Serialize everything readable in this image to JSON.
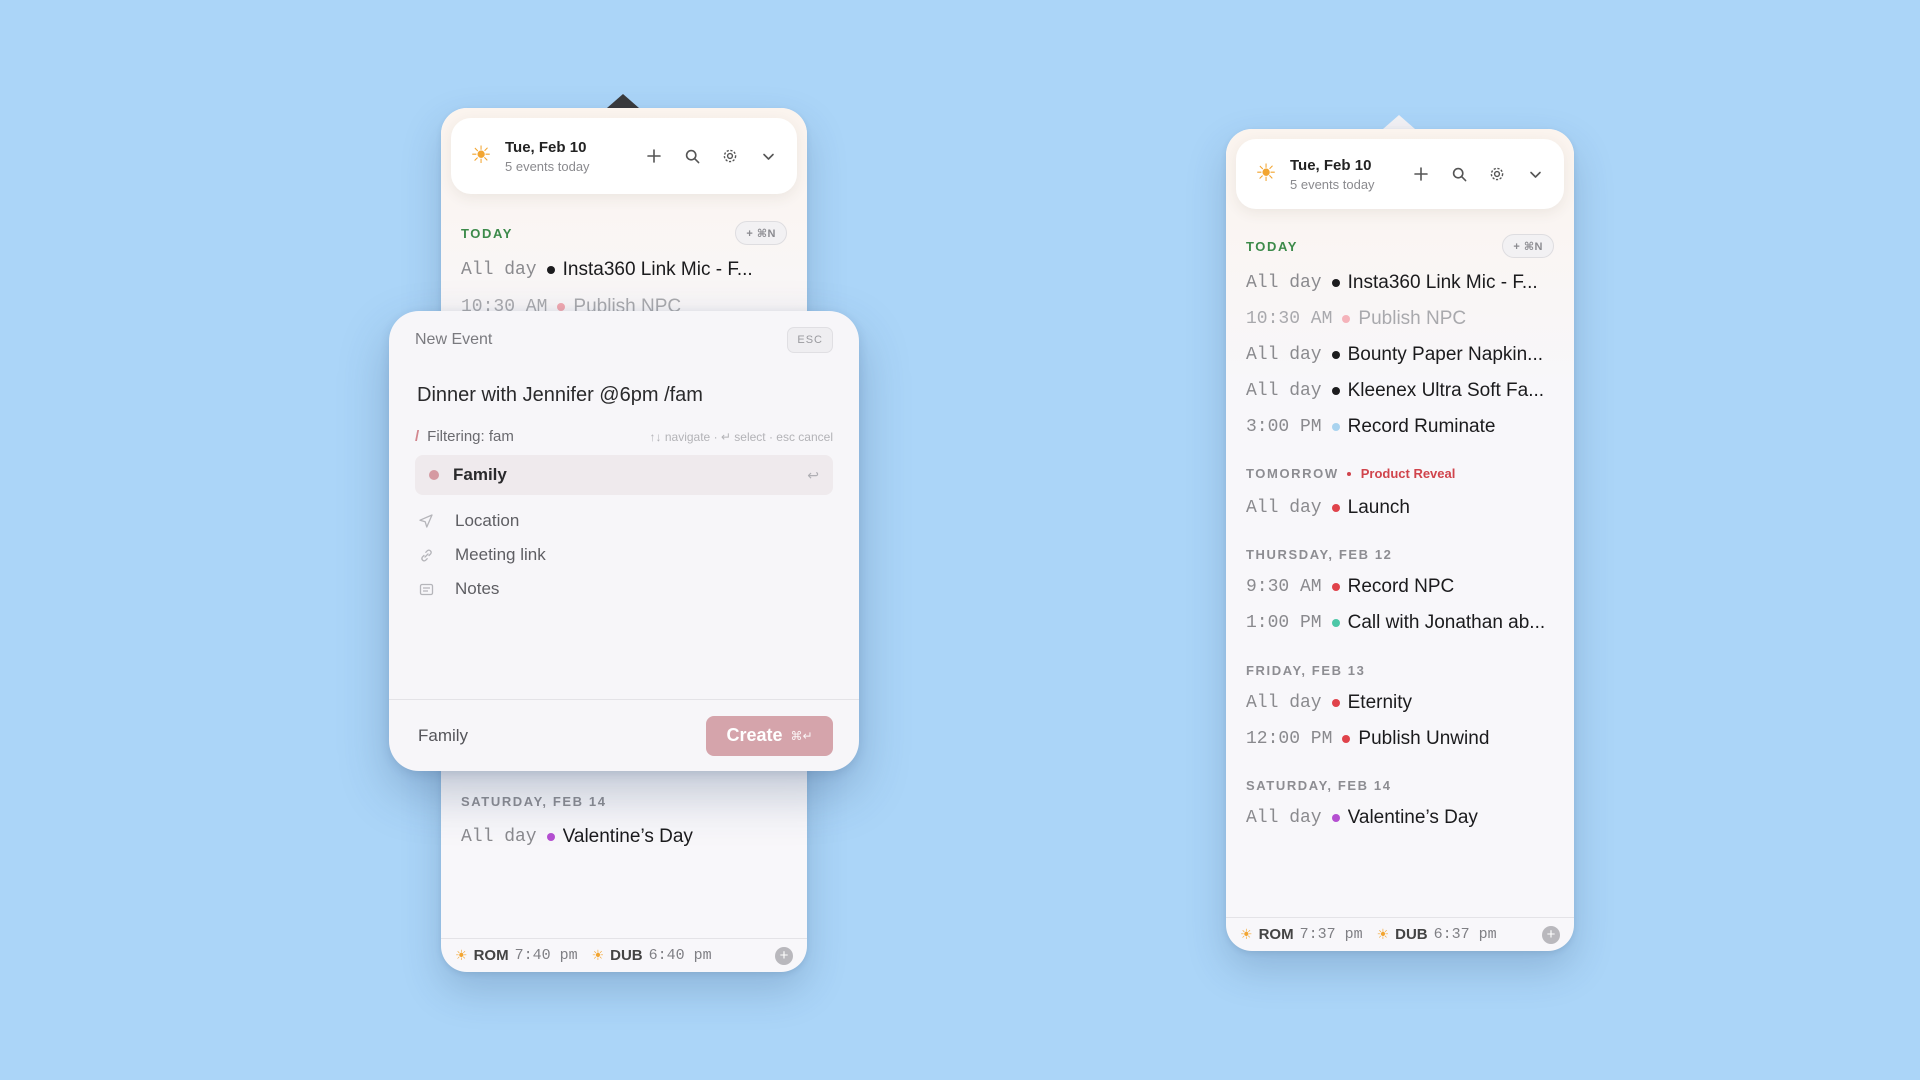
{
  "left": {
    "header": {
      "date": "Tue, Feb 10",
      "subtitle": "5 events today"
    },
    "today_label": "TODAY",
    "add_shortcut": "+ ⌘N",
    "rows": [
      {
        "time": "All day",
        "title": "Insta360 Link Mic - F...",
        "color": "#1c1c1e"
      },
      {
        "time": "10:30 AM",
        "title": "Publish NPC",
        "color": "#f2a8b0"
      }
    ],
    "saturday_label": "SATURDAY, FEB 14",
    "saturday_rows": [
      {
        "time": "All day",
        "title": "Valentine’s Day",
        "color": "#b54fd1"
      }
    ],
    "footer": {
      "city1": "ROM",
      "time1": "7:40 pm",
      "city2": "DUB",
      "time2": "6:40 pm"
    }
  },
  "modal": {
    "title": "New Event",
    "esc": "ESC",
    "input_value": "Dinner with Jennifer @6pm /fam",
    "filter_label": "Filtering: fam",
    "hint": "↑↓ navigate · ↵ select · esc cancel",
    "option": "Family",
    "fields": [
      "Location",
      "Meeting link",
      "Notes"
    ],
    "calendar": "Family",
    "create_label": "Create",
    "create_shortcut": "⌘↵"
  },
  "right": {
    "header": {
      "date": "Tue, Feb 10",
      "subtitle": "5 events today"
    },
    "today_label": "TODAY",
    "add_shortcut": "+ ⌘N",
    "today_rows": [
      {
        "time": "All day",
        "title": "Insta360 Link Mic - F...",
        "color": "#1c1c1e",
        "faded": false
      },
      {
        "time": "10:30 AM",
        "title": "Publish NPC",
        "color": "#f5b3ba",
        "faded": true
      },
      {
        "time": "All day",
        "title": "Bounty Paper Napkin...",
        "color": "#1c1c1e",
        "faded": false
      },
      {
        "time": "All day",
        "title": "Kleenex Ultra Soft Fa...",
        "color": "#1c1c1e",
        "faded": false
      },
      {
        "time": "3:00 PM",
        "title": "Record Ruminate",
        "color": "#a9d3ef",
        "faded": false
      }
    ],
    "tomorrow_label": "TOMORROW",
    "tomorrow_tag": "Product Reveal",
    "tomorrow_rows": [
      {
        "time": "All day",
        "title": "Launch",
        "color": "#e0434b"
      }
    ],
    "thursday_label": "THURSDAY, FEB 12",
    "thursday_rows": [
      {
        "time": "9:30 AM",
        "title": "Record NPC",
        "color": "#e0434b"
      },
      {
        "time": "1:00 PM",
        "title": "Call with Jonathan ab...",
        "color": "#4cc7a7"
      }
    ],
    "friday_label": "FRIDAY, FEB 13",
    "friday_rows": [
      {
        "time": "All day",
        "title": "Eternity",
        "color": "#e0434b"
      },
      {
        "time": "12:00 PM",
        "title": "Publish Unwind",
        "color": "#e0434b"
      }
    ],
    "saturday_label": "SATURDAY, FEB 14",
    "saturday_rows": [
      {
        "time": "All day",
        "title": "Valentine’s Day",
        "color": "#b54fd1"
      }
    ],
    "footer": {
      "city1": "ROM",
      "time1": "7:37 pm",
      "city2": "DUB",
      "time2": "6:37 pm"
    }
  }
}
